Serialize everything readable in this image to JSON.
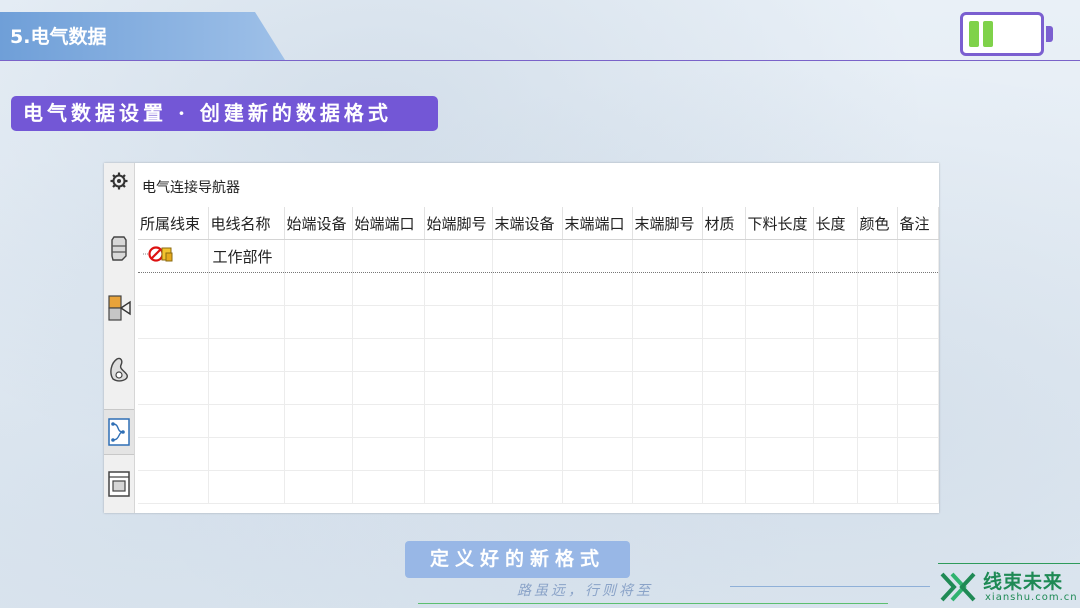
{
  "header": {
    "title": "5.电气数据"
  },
  "section": {
    "label": "电气数据设置 · 创建新的数据格式"
  },
  "window": {
    "panel_title": "电气连接导航器",
    "tools": [
      "gear-icon",
      "bracket-icon",
      "connector-valve-icon",
      "clip-icon",
      "wiring-diagram-icon",
      "device-icon"
    ],
    "columns": [
      "所属线束",
      "电线名称",
      "始端设备",
      "始端端口",
      "始端脚号",
      "末端设备",
      "末端端口",
      "末端脚号",
      "材质",
      "下料长度",
      "长度",
      "颜色",
      "备注"
    ],
    "rows": [
      {
        "harness_icon": "no-entry-assembly-icon",
        "wire_name": "工作部件"
      }
    ]
  },
  "caption": "定义好的新格式",
  "slogan": "路虽远，行则将至",
  "brand": {
    "name": "线束未来",
    "url": "xianshu.com.cn"
  },
  "colors": {
    "accent": "#7357d6",
    "battery": "#7fd24a",
    "brand": "#1f8a55"
  }
}
